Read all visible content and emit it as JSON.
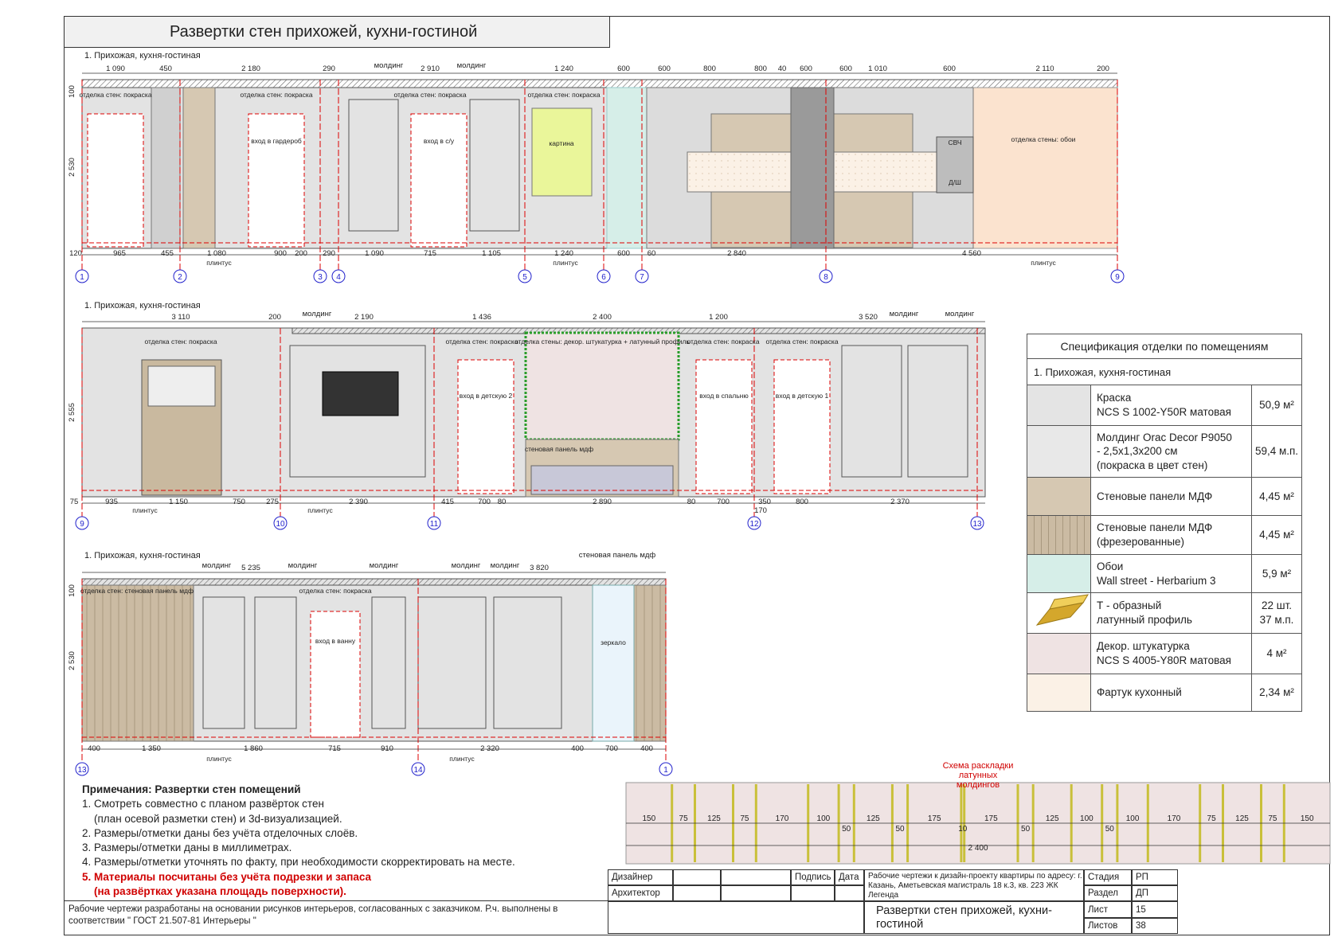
{
  "title": "Развертки стен прихожей, кухни-гостиной",
  "section_label": "1. Прихожая, кухня-гостиная",
  "elevation1": {
    "top_dims": [
      "1 090",
      "450",
      "2 180",
      "290",
      "молдинг",
      "2 910",
      "молдинг",
      "1 240",
      "600",
      "600",
      "800",
      "800",
      "40",
      "600",
      "600",
      "1 010",
      "600",
      "2 110",
      "200"
    ],
    "bottom_dims": [
      "120",
      "965",
      "455",
      "1 080",
      "900",
      "200",
      "290",
      "1 090",
      "715",
      "1 105",
      "1 240",
      "600",
      "60",
      "2 840",
      "4 560"
    ],
    "left_dims": [
      "100",
      "2 530"
    ],
    "labels": [
      "отделка стен: покраска",
      "отделка стен: покраска",
      "отделка стен: покраска",
      "отделка стен: покраска",
      "отделка стены: обои"
    ],
    "room_labels": [
      "вход в гардероб",
      "вход в с/у",
      "картина",
      "СВЧ",
      "Д/Ш"
    ],
    "plinth": "плинтус",
    "axes": [
      "1",
      "2",
      "3",
      "4",
      "5",
      "6",
      "7",
      "8",
      "9"
    ]
  },
  "elevation2": {
    "top_dims": [
      "3 110",
      "200",
      "молдинг",
      "2 190",
      "1 436",
      "2 400",
      "1 200",
      "3 520",
      "молдинг",
      "молдинг"
    ],
    "bottom_dims": [
      "75",
      "935",
      "1 150",
      "750",
      "275",
      "2 390",
      "415",
      "700",
      "80",
      "2 890",
      "80",
      "700",
      "350",
      "800",
      "2 370",
      "170"
    ],
    "left_dims": [
      "2 555"
    ],
    "labels": [
      "отделка стен: покраска",
      "отделка стен: покраска",
      "отделка стены: декор. штукатурка + латунный профиль",
      "отделка стен: покраска",
      "отделка стен: покраска"
    ],
    "room_labels": [
      "вход в детскую 2",
      "вход в спальню",
      "вход в детскую 1",
      "стеновая панель мдф"
    ],
    "plinth": "плинтус",
    "axes": [
      "9",
      "10",
      "11",
      "12",
      "13"
    ]
  },
  "elevation3": {
    "top_dims": [
      "молдинг",
      "5 235",
      "молдинг",
      "молдинг",
      "молдинг",
      "молдинг",
      "3 820",
      "стеновая панель мдф"
    ],
    "bottom_dims": [
      "400",
      "1 350",
      "1 860",
      "715",
      "910",
      "2 320",
      "400",
      "700",
      "400"
    ],
    "left_dims": [
      "100",
      "2 530"
    ],
    "labels": [
      "отделка стен: стеновая панель мдф",
      "отделка стен: покраска"
    ],
    "room_labels": [
      "вход в ванну",
      "зеркало"
    ],
    "plinth": "плинтус",
    "axes": [
      "13",
      "14",
      "1"
    ]
  },
  "spec": {
    "header": "Спецификация отделки по помещениям",
    "subheader": "1. Прихожая, кухня-гостиная",
    "rows": [
      {
        "name": "Краска\nNCS S 1002-Y50R матовая",
        "value": "50,9 м²",
        "swatch": "#e4e4e4"
      },
      {
        "name": "Молдинг Orac Decor P9050\n- 2,5x1,3x200 см\n(покраска в цвет стен)",
        "value": "59,4 м.п.",
        "swatch": "#e8e8e8"
      },
      {
        "name": "Стеновые панели МДФ",
        "value": "4,45 м²",
        "swatch": "#d6c8b2"
      },
      {
        "name": "Стеновые панели МДФ\n(фрезерованные)",
        "value": "4,45 м²",
        "swatch": "#cbbba3"
      },
      {
        "name": "Обои\nWall street - Herbarium 3",
        "value": "5,9 м²",
        "swatch": "#d6eee8"
      },
      {
        "name": "Т - образный\nлатунный профиль",
        "value": "22 шт.\n37 м.п.",
        "swatch": "#ffffff"
      },
      {
        "name": "Декор. штукатурка\nNCS S 4005-Y80R матовая",
        "value": "4 м²",
        "swatch": "#efe3e3"
      },
      {
        "name": "Фартук кухонный",
        "value": "2,34 м²",
        "swatch": "#fbf1e6"
      }
    ]
  },
  "notes": {
    "title": "Примечания: Развертки стен помещений",
    "items": [
      "1. Смотреть совместно с планом развёрток стен",
      "    (план осевой разметки стен) и 3d-визуализацией.",
      "2. Размеры/отметки даны без учёта отделочных слоёв.",
      "3. Размеры/отметки даны в миллиметрах.",
      "4. Размеры/отметки уточнять по факту, при необходимости скорректировать на месте."
    ],
    "red_items": [
      "5. Материалы посчитаны без учёта подрезки и запаса",
      "    (на развёртках указана площадь поверхности)."
    ]
  },
  "bottom_note": "Рабочие чертежи разработаны на основании рисунков интерьеров, согласованных с заказчиком. Р.ч. выполнены в соответствии \" ГОСТ 21.507-81 Интерьеры \"",
  "layout_scheme": {
    "title": "Схема раскладки латунных молдингов",
    "dims": [
      "150",
      "75",
      "125",
      "75",
      "170",
      "100",
      "50",
      "125",
      "50",
      "175",
      "10",
      "175",
      "50",
      "125",
      "100",
      "50",
      "100",
      "170",
      "75",
      "125",
      "75",
      "150"
    ],
    "total": "2 400"
  },
  "stamp": {
    "designer": "Дизайнер",
    "architect": "Архитектор",
    "signature": "Подпись",
    "date": "Дата",
    "project": "Рабочие чертежи к дизайн-проекту квартиры по адресу: г. Казань, Аметьевская магистраль 18 к.3, кв. 223 ЖК Легенда",
    "sheet_title": "Развертки стен прихожей, кухни-гостиной",
    "stage_label": "Стадия",
    "stage": "РП",
    "section_label": "Раздел",
    "section": "ДП",
    "sheet_label": "Лист",
    "sheet": "15",
    "sheets_label": "Листов",
    "sheets": "38"
  }
}
